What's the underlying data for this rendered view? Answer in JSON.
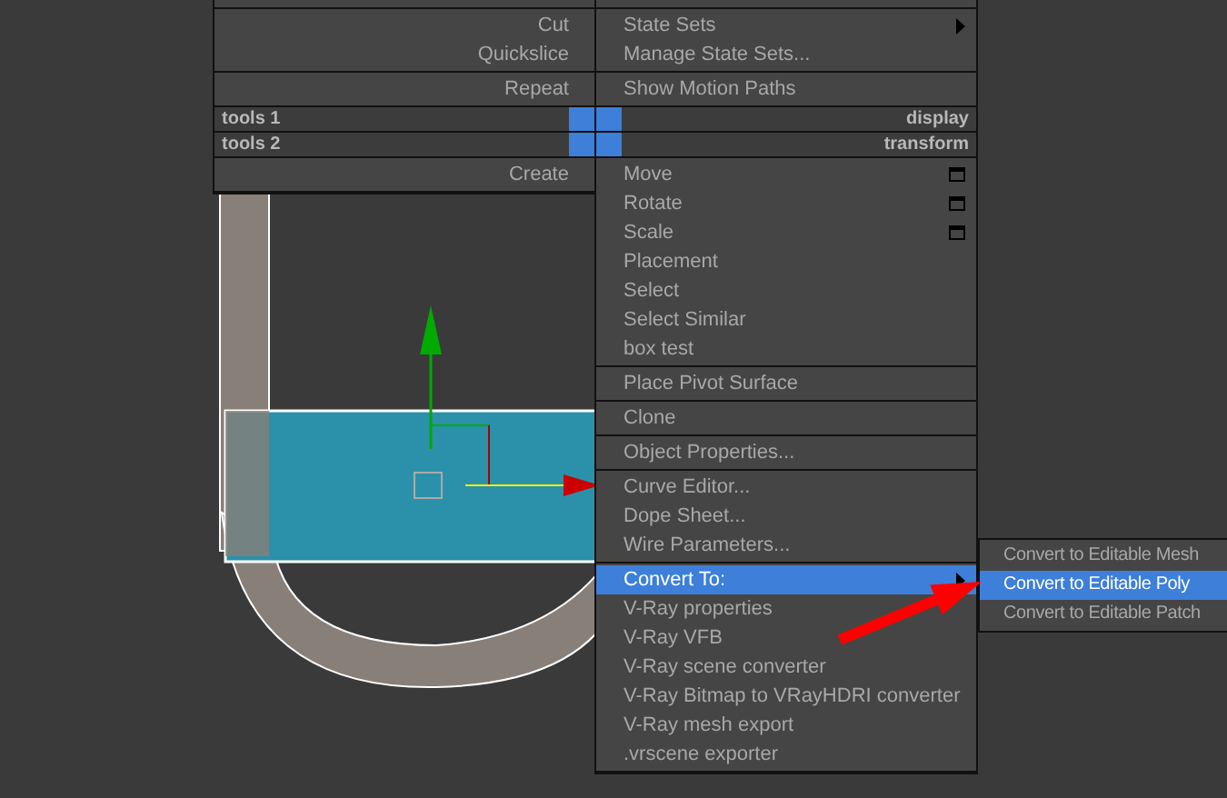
{
  "left_menu": {
    "groups": [
      {
        "items": [
          {
            "label": "Cut",
            "selected": false
          },
          {
            "label": "Quickslice",
            "selected": false
          }
        ]
      },
      {
        "items": [
          {
            "label": "Repeat",
            "selected": false
          }
        ]
      }
    ],
    "headers": [
      "tools 1",
      "tools 2"
    ],
    "bottom_groups": [
      {
        "items": [
          {
            "label": "Create",
            "selected": false
          }
        ]
      }
    ]
  },
  "right_menu": {
    "groups": [
      {
        "items": [
          {
            "label": "State Sets",
            "kind": "submenu",
            "selected": false
          },
          {
            "label": "Manage State Sets...",
            "kind": "plain",
            "selected": false
          }
        ]
      },
      {
        "items": [
          {
            "label": "Show Motion Paths",
            "kind": "plain",
            "selected": false
          }
        ]
      }
    ],
    "headers": [
      "display",
      "transform"
    ],
    "bottom_groups": [
      {
        "items": [
          {
            "label": "Move",
            "kind": "options",
            "selected": false
          },
          {
            "label": "Rotate",
            "kind": "options",
            "selected": false
          },
          {
            "label": "Scale",
            "kind": "options",
            "selected": false
          },
          {
            "label": "Placement",
            "kind": "plain",
            "selected": false
          },
          {
            "label": "Select",
            "kind": "plain",
            "selected": false
          },
          {
            "label": "Select Similar",
            "kind": "plain",
            "selected": false
          },
          {
            "label": "box test",
            "kind": "plain",
            "selected": false
          }
        ]
      },
      {
        "items": [
          {
            "label": "Place Pivot Surface",
            "kind": "plain",
            "selected": false
          }
        ]
      },
      {
        "items": [
          {
            "label": "Clone",
            "kind": "plain",
            "selected": false
          }
        ]
      },
      {
        "items": [
          {
            "label": "Object Properties...",
            "kind": "plain",
            "selected": false
          }
        ]
      },
      {
        "items": [
          {
            "label": "Curve Editor...",
            "kind": "plain",
            "selected": false
          },
          {
            "label": "Dope Sheet...",
            "kind": "plain",
            "selected": false
          },
          {
            "label": "Wire Parameters...",
            "kind": "plain",
            "selected": false
          }
        ]
      },
      {
        "items": [
          {
            "label": "Convert To:",
            "kind": "submenu",
            "selected": true
          },
          {
            "label": "V-Ray properties",
            "kind": "plain",
            "selected": false
          },
          {
            "label": "V-Ray VFB",
            "kind": "plain",
            "selected": false
          },
          {
            "label": "V-Ray scene converter",
            "kind": "plain",
            "selected": false
          },
          {
            "label": "V-Ray Bitmap to VRayHDRI converter",
            "kind": "plain",
            "selected": false
          },
          {
            "label": "V-Ray mesh export",
            "kind": "plain",
            "selected": false
          },
          {
            "label": ".vrscene exporter",
            "kind": "plain",
            "selected": false
          }
        ]
      }
    ]
  },
  "submenu": {
    "items": [
      {
        "label": "Convert to Editable Mesh",
        "selected": false
      },
      {
        "label": "Convert to Editable Poly",
        "selected": true
      },
      {
        "label": "Convert to Editable Patch",
        "selected": false
      }
    ]
  }
}
